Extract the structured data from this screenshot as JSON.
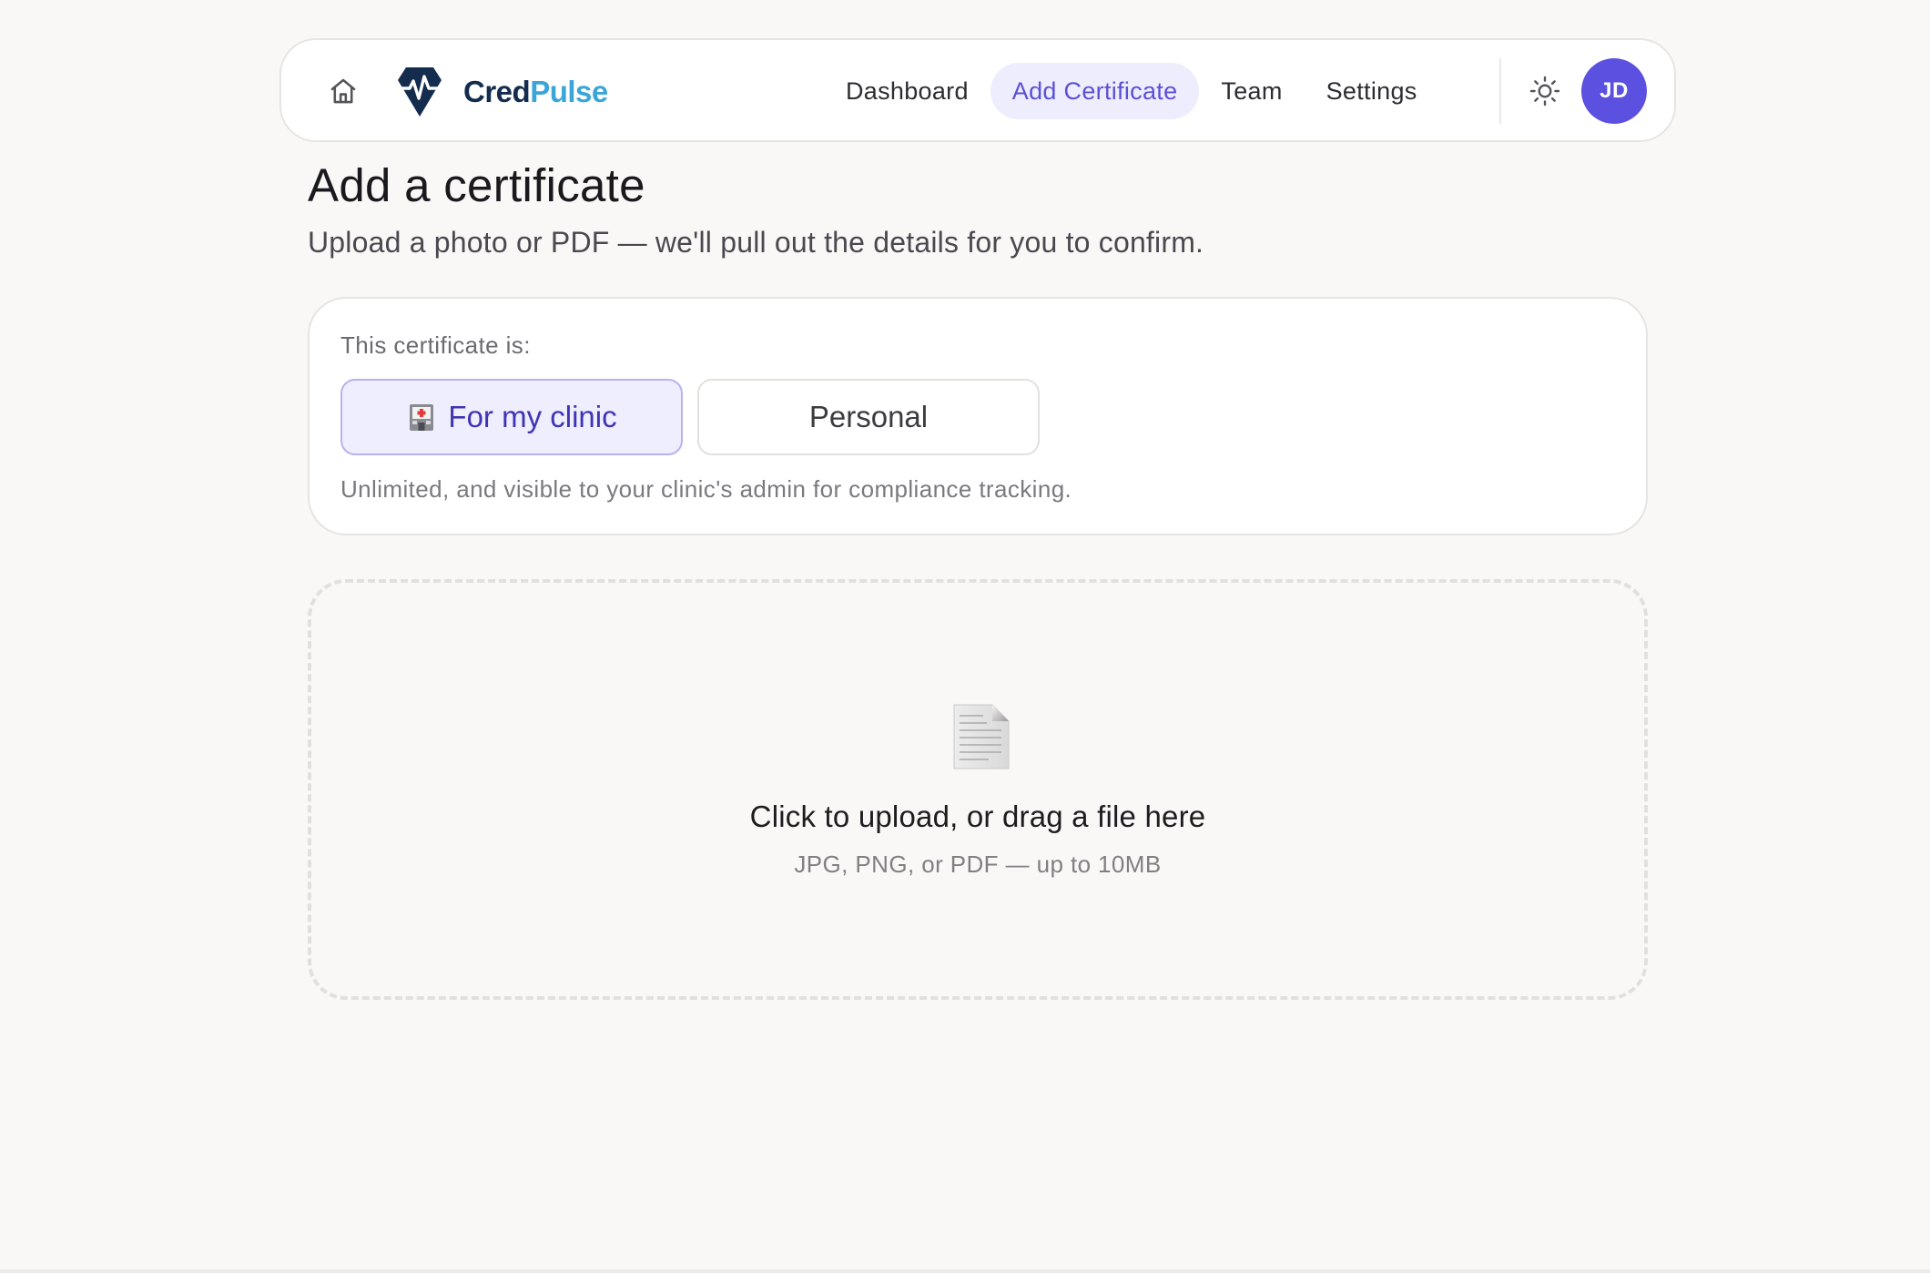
{
  "brand": {
    "name_part1": "Cred",
    "name_part2": "Pulse",
    "colors": {
      "navy": "#142c4e",
      "sky": "#3aa6d8",
      "accent": "#5b50e0"
    }
  },
  "nav": {
    "home_icon": "home-icon",
    "links": [
      {
        "label": "Dashboard",
        "active": false
      },
      {
        "label": "Add Certificate",
        "active": true
      },
      {
        "label": "Team",
        "active": false
      },
      {
        "label": "Settings",
        "active": false
      }
    ],
    "theme_icon": "sun-icon",
    "avatar_initials": "JD"
  },
  "page": {
    "title": "Add a certificate",
    "subtitle": "Upload a photo or PDF — we'll pull out the details for you to confirm."
  },
  "certificate_type": {
    "label": "This certificate is:",
    "options": [
      {
        "label": "For my clinic",
        "icon": "hospital-icon",
        "selected": true
      },
      {
        "label": "Personal",
        "selected": false
      }
    ],
    "help_text": "Unlimited, and visible to your clinic's admin for compliance tracking."
  },
  "upload": {
    "icon": "document-icon",
    "title": "Click to upload, or drag a file here",
    "hint": "JPG, PNG, or PDF — up to 10MB"
  }
}
